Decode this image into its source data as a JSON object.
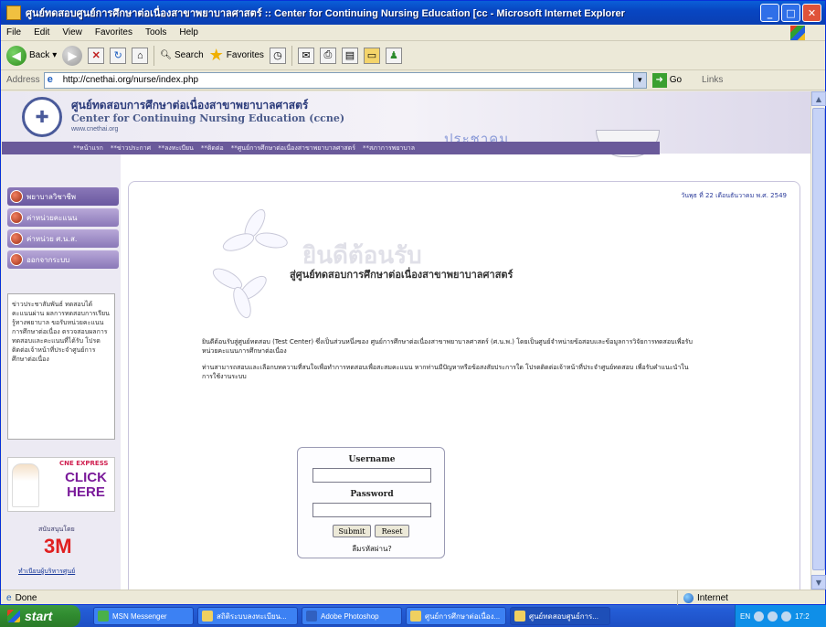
{
  "window": {
    "title": "ศูนย์ทดสอบศูนย์การศึกษาต่อเนื่องสาขาพยาบาลศาสตร์ :: Center for Continuing Nursing Education [cc - Microsoft Internet Explorer",
    "minimize": "_",
    "maximize": "□",
    "close": "✕"
  },
  "menu": [
    "File",
    "Edit",
    "View",
    "Favorites",
    "Tools",
    "Help"
  ],
  "toolbar": {
    "back": "Back",
    "search": "Search",
    "favorites": "Favorites"
  },
  "address": {
    "label": "Address",
    "url": "http://cnethai.org/nurse/index.php",
    "go": "Go",
    "links": "Links"
  },
  "site": {
    "title_th": "ศูนย์ทดสอบการศึกษาต่อเนื่องสาขาพยาบาลศาสตร์",
    "title_en": "Center for Continuing Nursing Education (ccne)",
    "url": "www.cnethai.org",
    "header_watermark": "ประชาคม",
    "nav": [
      "**หน้าแรก",
      "**ข่าวประกาศ",
      "**ลงทะเบียน",
      "**ติดต่อ",
      "**ศูนย์การศึกษาต่อเนื่องสาขาพยาบาลศาสตร์",
      "**สภาการพยาบาล"
    ]
  },
  "sidebar": {
    "items": [
      "พยาบาลวิชาชีพ",
      "ค่าหน่วยคะแนน",
      "ค่าหน่วย ศ.น.ส.",
      "ออกจากระบบ"
    ],
    "news": "ข่าวประชาสัมพันธ์ ทดสอบได้คะแนนผ่าน ผลการทดสอบการเรียนรู้ทางพยาบาล ขอรับหน่วยคะแนนการศึกษาต่อเนื่อง ตรวจสอบผลการทดสอบและคะแนนที่ได้รับ โปรดติดต่อเจ้าหน้าที่ประจำศูนย์การศึกษาต่อเนื่อง",
    "ad_express": "CNE EXPRESS",
    "ad_click": "CLICK HERE",
    "sponsor_label": "สนับสนุนโดย",
    "sponsor": "3M",
    "footer_link": "ทำเนียบผู้บริหารศูนย์"
  },
  "main": {
    "date": "วันพุธ ที่ 22 เดือนธันวาคม พ.ศ. 2549",
    "welcome_ghost": "ยินดีต้อนรับ",
    "welcome_title": "สู่ศูนย์ทดสอบการศึกษาต่อเนื่องสาขาพยาบาลศาสตร์",
    "intro1": "ยินดีต้อนรับสู่ศูนย์ทดสอบ (Test Center) ซึ่งเป็นส่วนหนึ่งของ ศูนย์การศึกษาต่อเนื่องสาขาพยาบาลศาสตร์ (ศ.น.พ.) โดยเป็นศูนย์จำหน่ายข้อสอบและข้อมูลการวิจัยการทดสอบเพื่อรับหน่วยคะแนนการศึกษาต่อเนื่อง",
    "intro2": "ท่านสามารถสอบและเลือกบทความที่สนใจเพื่อทำการทดสอบเพื่อสะสมคะแนน หากท่านมีปัญหาหรือข้อสงสัยประการใด โปรดติดต่อเจ้าหน้าที่ประจำศูนย์ทดสอบ เพื่อรับคำแนะนำในการใช้งานระบบ",
    "login": {
      "username_label": "Username",
      "password_label": "Password",
      "username": "",
      "password": "",
      "submit": "Submit",
      "reset": "Reset",
      "forgot": "ลืมรหัสผ่าน?"
    }
  },
  "status": {
    "text": "Done",
    "zone": "Internet"
  },
  "taskbar": {
    "start": "start",
    "tasks": [
      "MSN Messenger",
      "สถิติระบบลงทะเบียน...",
      "Adobe Photoshop",
      "ศูนย์การศึกษาต่อเนื่อง...",
      "ศูนย์ทดสอบศูนย์การ..."
    ],
    "tray": "EN",
    "clock": "17:2"
  }
}
